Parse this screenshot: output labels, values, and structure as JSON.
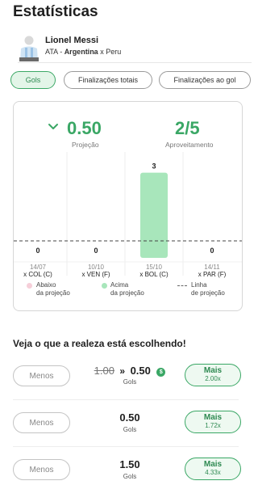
{
  "page": {
    "title": "Estatísticas"
  },
  "player": {
    "name": "Lionel Messi",
    "position": "ATA",
    "team": "Argentina",
    "opponent_text": "x Peru"
  },
  "tabs": [
    {
      "label": "Gols",
      "active": true
    },
    {
      "label": "Finalizações totais",
      "active": false
    },
    {
      "label": "Finalizações ao gol",
      "active": false
    }
  ],
  "summary": {
    "projection_value": "0.50",
    "projection_label": "Projeção",
    "hit_value": "2/5",
    "hit_label": "Aproveitamento"
  },
  "chart_data": {
    "type": "bar",
    "categories": [
      "14/07",
      "10/10",
      "15/10",
      "14/11"
    ],
    "opponents": [
      "x COL (C)",
      "x VEN (F)",
      "x BOL (C)",
      "x PAR (F)"
    ],
    "values": [
      0,
      0,
      3,
      0
    ],
    "value_labels": [
      "0",
      "0",
      "3",
      "0"
    ],
    "projection_line": 0.5,
    "ylim": [
      0,
      3.5
    ],
    "colors": {
      "above": "#a8e6bb",
      "below": "#f8d3dc"
    }
  },
  "legend": [
    {
      "label_line1": "Abaixo",
      "label_line2": "da projeção",
      "color": "#f6cfd9"
    },
    {
      "label_line1": "Acima",
      "label_line2": "da projeção",
      "color": "#a8e6bb"
    },
    {
      "label_line1": "Linha",
      "label_line2": "de projeção",
      "color": "#666666"
    }
  ],
  "picks": {
    "title": "Veja o que a realeza está escolhendo!",
    "rows": [
      {
        "less_label": "Menos",
        "old_line": "1.00",
        "line": "0.50",
        "stat": "Gols",
        "more_label": "Mais",
        "multiplier": "2.00x",
        "promo": true
      },
      {
        "less_label": "Menos",
        "old_line": "",
        "line": "0.50",
        "stat": "Gols",
        "more_label": "Mais",
        "multiplier": "1.72x",
        "promo": false
      },
      {
        "less_label": "Menos",
        "old_line": "",
        "line": "1.50",
        "stat": "Gols",
        "more_label": "Mais",
        "multiplier": "4.33x",
        "promo": false
      }
    ]
  },
  "colors": {
    "accent": "#3aa765",
    "accent_light": "#e3f5e8"
  }
}
